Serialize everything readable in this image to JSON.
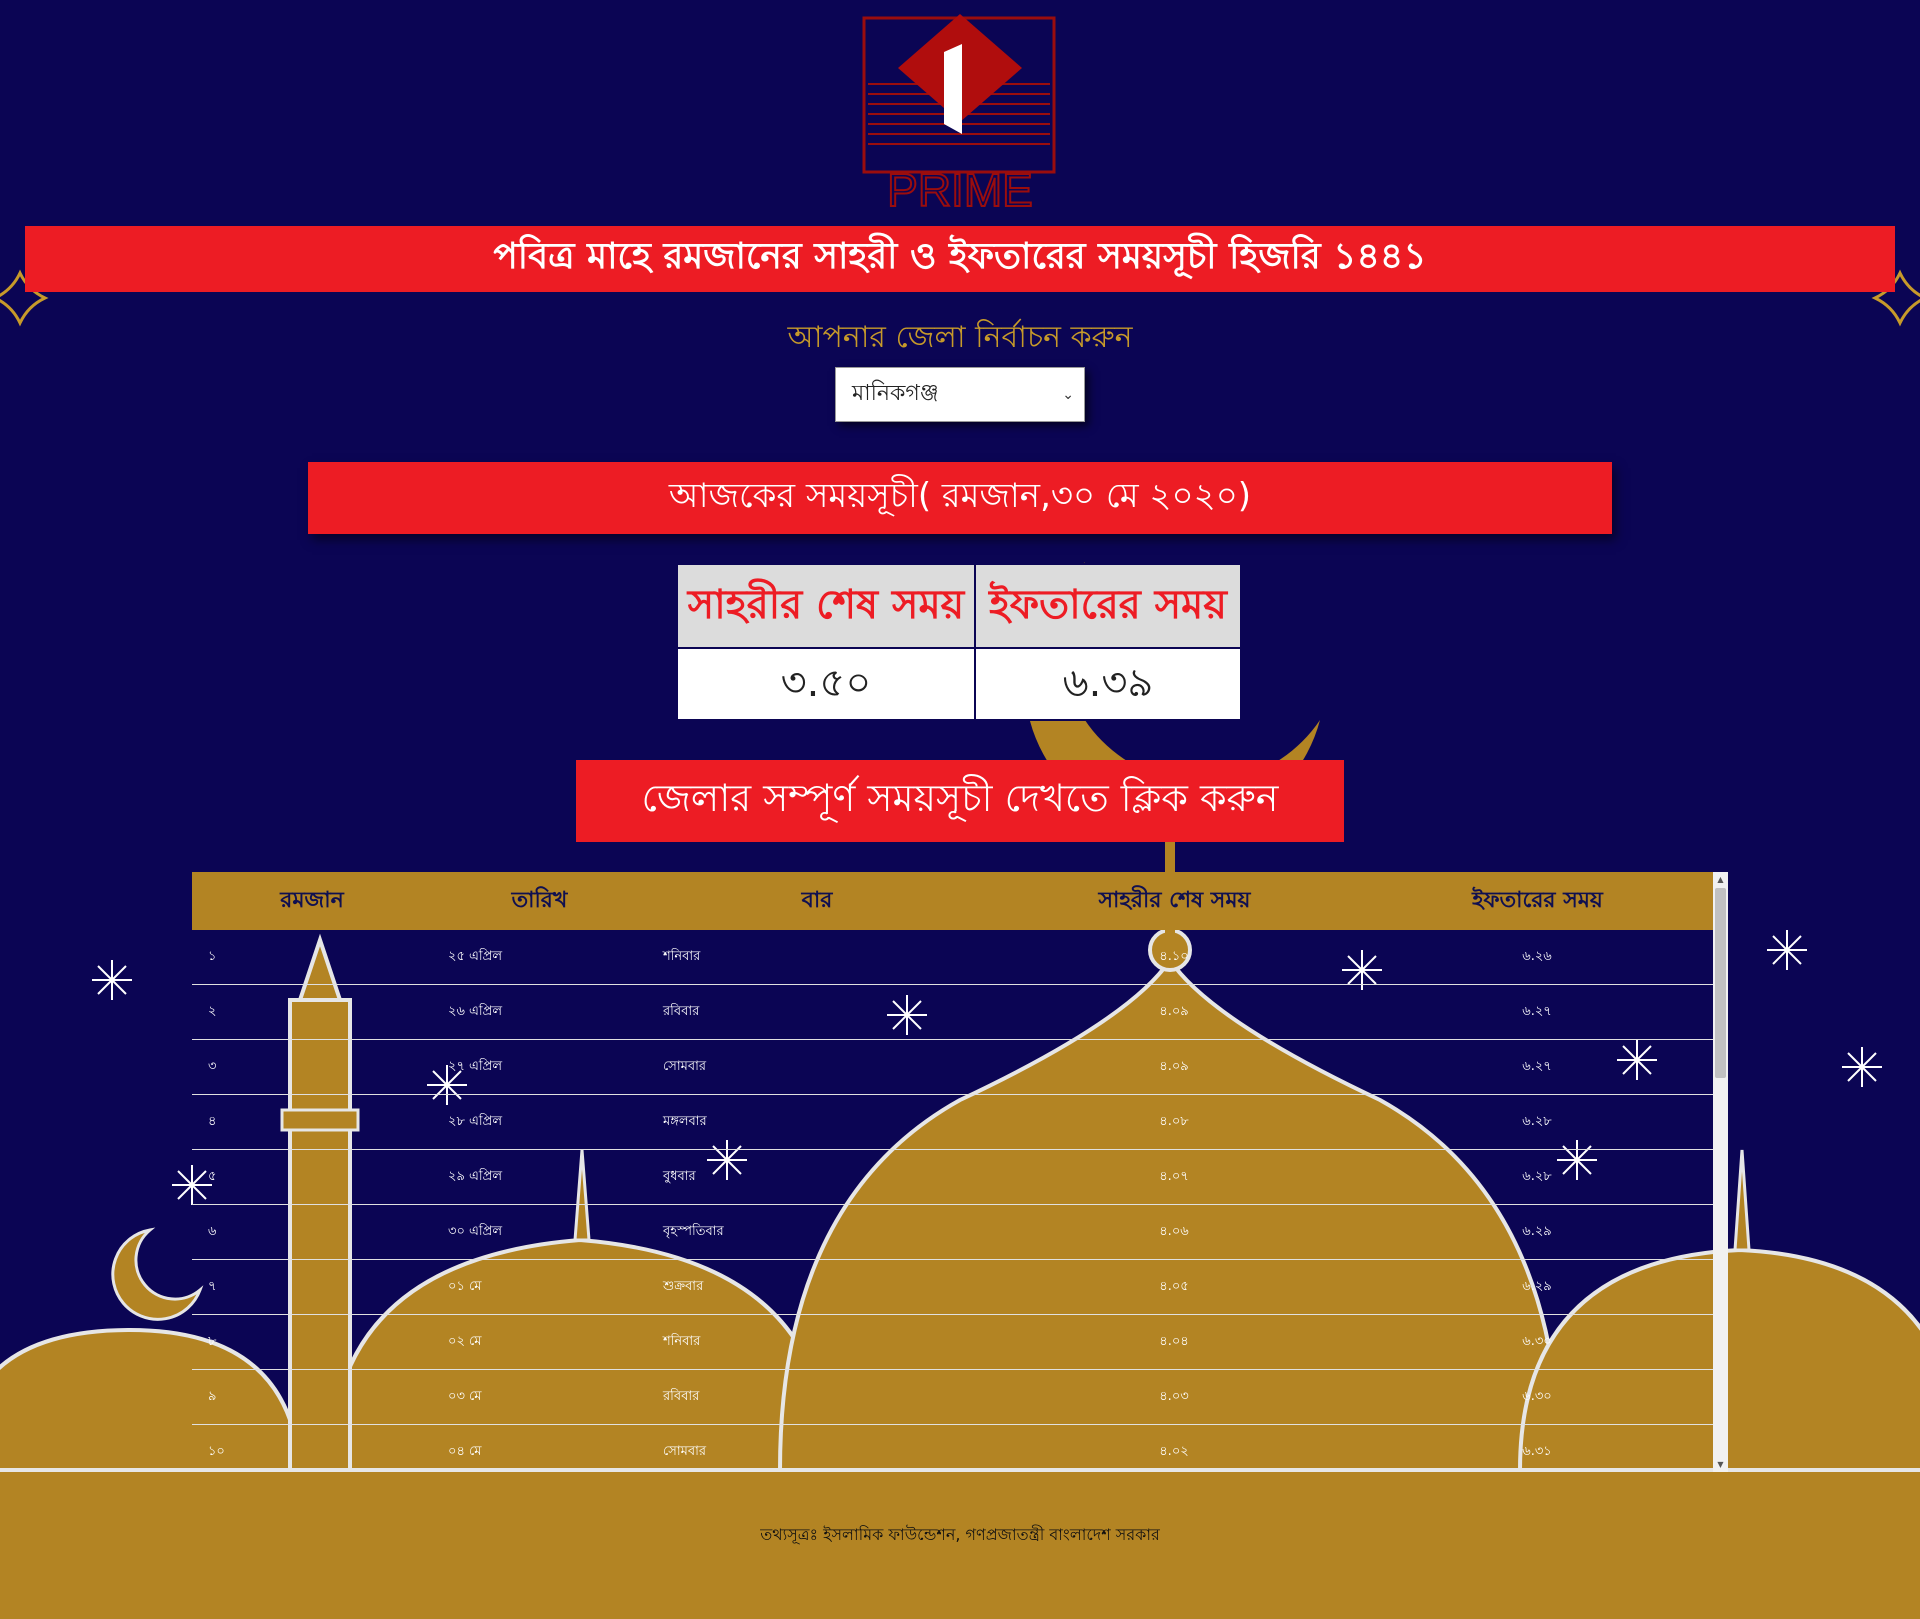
{
  "logo": {
    "text": "PRIME"
  },
  "header": {
    "title": "পবিত্র মাহে রমজানের সাহরী ও ইফতারের সময়সূচী হিজরি ১৪৪১"
  },
  "district": {
    "label": "আপনার জেলা নির্বাচন করুন",
    "selected": "মানিকগঞ্জ"
  },
  "today": {
    "heading": "আজকের সময়সূচী( রমজান,৩০ মে ২০২০)",
    "sehri_label": "সাহরীর শেষ সময়",
    "iftar_label": "ইফতারের সময়",
    "sehri_time": "৩.৫০",
    "iftar_time": "৬.৩৯"
  },
  "full_schedule_button": "জেলার সম্পূর্ণ সময়সূচী দেখতে ক্লিক করুন",
  "schedule": {
    "headers": [
      "রমজান",
      "তারিখ",
      "বার",
      "সাহরীর শেষ সময়",
      "ইফতারের সময়"
    ],
    "rows": [
      [
        "১",
        "২৫ এপ্রিল",
        "শনিবার",
        "৪.১০",
        "৬.২৬"
      ],
      [
        "২",
        "২৬ এপ্রিল",
        "রবিবার",
        "৪.০৯",
        "৬.২৭"
      ],
      [
        "৩",
        "২৭ এপ্রিল",
        "সোমবার",
        "৪.০৯",
        "৬.২৭"
      ],
      [
        "৪",
        "২৮ এপ্রিল",
        "মঙ্গলবার",
        "৪.০৮",
        "৬.২৮"
      ],
      [
        "৫",
        "২৯ এপ্রিল",
        "বুধবার",
        "৪.০৭",
        "৬.২৮"
      ],
      [
        "৬",
        "৩০ এপ্রিল",
        "বৃহস্পতিবার",
        "৪.০৬",
        "৬.২৯"
      ],
      [
        "৭",
        "০১ মে",
        "শুক্রবার",
        "৪.০৫",
        "৬.২৯"
      ],
      [
        "৮",
        "০২ মে",
        "শনিবার",
        "৪.০৪",
        "৬.৩০"
      ],
      [
        "৯",
        "০৩ মে",
        "রবিবার",
        "৪.০৩",
        "৬.৩০"
      ],
      [
        "১০",
        "০৪ মে",
        "সোমবার",
        "৪.০২",
        "৬.৩১"
      ]
    ]
  },
  "footer": "তথ্যসূত্রঃ ইসলামিক ফাউন্ডেশন, গণপ্রজাতন্ত্রী বাংলাদেশ সরকার",
  "colors": {
    "background": "#0b0554",
    "accent_red": "#ed1c24",
    "gold": "#b38423",
    "label_gold": "#c79a2a"
  }
}
